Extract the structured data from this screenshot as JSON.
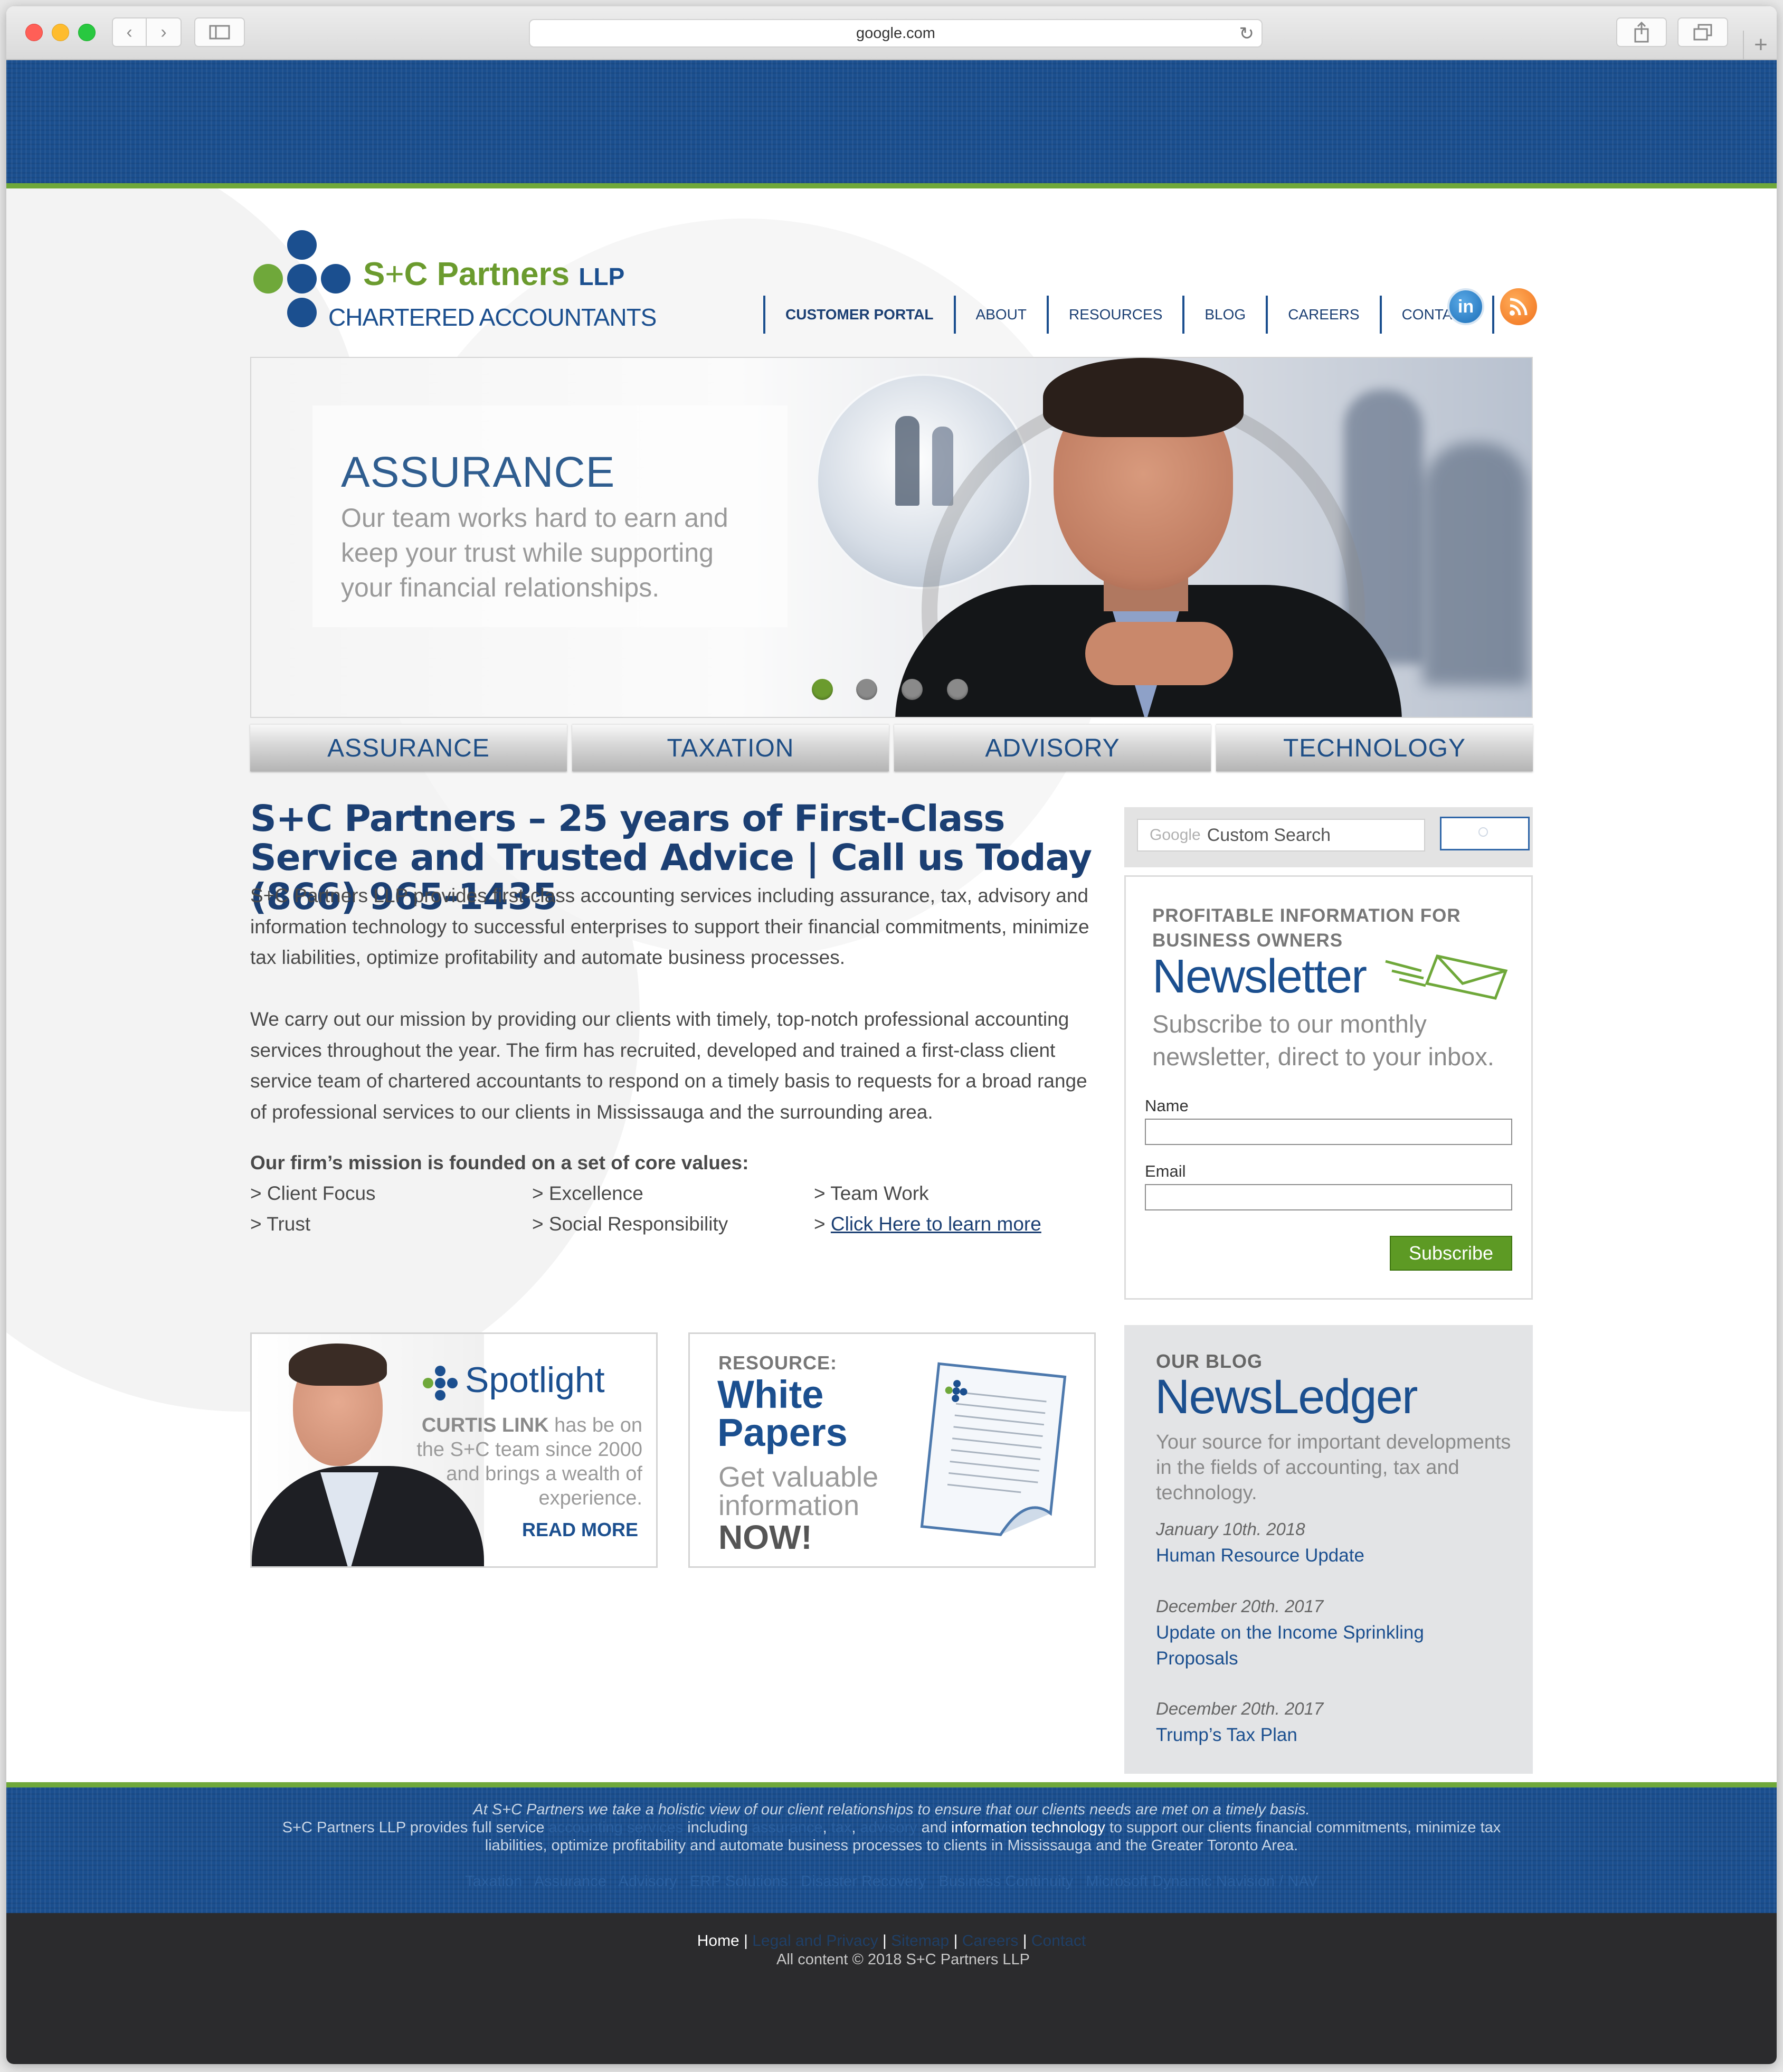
{
  "browser": {
    "url": "google.com",
    "colors": {
      "close": "#ff5f57",
      "minimize": "#febc2e",
      "maximize": "#28c840"
    }
  },
  "logo": {
    "name_s": "S",
    "name_plus": "+",
    "name_rest": "C Partners ",
    "name_llp": "LLP",
    "subtitle": "CHARTERED ACCOUNTANTS"
  },
  "nav": {
    "items": [
      "CUSTOMER PORTAL",
      "ABOUT",
      "RESOURCES",
      "BLOG",
      "CAREERS",
      "CONTACT"
    ],
    "social": {
      "linkedin": "in",
      "rss_icon": "rss-icon"
    }
  },
  "hero": {
    "title": "ASSURANCE",
    "text": "Our team works hard to earn and keep your trust while supporting your financial relationships.",
    "slides": 4,
    "active_slide": 1
  },
  "services": [
    "ASSURANCE",
    "TAXATION",
    "ADVISORY",
    "TECHNOLOGY"
  ],
  "main": {
    "headline": "S+C Partners – 25 years of First-Class Service and Trusted Advice | Call us Today (866) 965-1435",
    "paragraph1": "S+C Partners LLP provides first-class accounting services including assurance, tax, advisory and information technology to successful enterprises to support their financial commitments, minimize tax liabilities, optimize profitability and automate business processes.",
    "paragraph2": "We carry out our mission by providing our clients with timely, top-notch professional accounting services throughout the year. The firm has recruited, developed and trained a first-class client service team of chartered accountants to respond on a timely basis to requests for a broad range of professional services to our clients in Mississauga and the surrounding area.",
    "values_heading": "Our firm’s mission is founded on a set of core values:",
    "values": [
      "> Client Focus",
      "> Excellence",
      "> Team Work",
      "> Trust",
      "> Social Responsibility"
    ],
    "learn_more_prefix": "> ",
    "learn_more_link": "Click Here to learn more"
  },
  "spotlight": {
    "title": "Spotlight",
    "name": "CURTIS LINK",
    "text": " has be on the S+C team since 2000 and brings a wealth of experience.",
    "cta": "READ MORE"
  },
  "whitepapers": {
    "kicker": "RESOURCE:",
    "title_line1": "White",
    "title_line2": "Papers",
    "text_line1": "Get valuable",
    "text_line2": "information",
    "text_line3": "NOW!"
  },
  "search": {
    "brand": "Google",
    "placeholder": "Custom Search"
  },
  "newsletter": {
    "kicker": "PROFITABLE INFORMATION FOR BUSINESS OWNERS",
    "title": "Newsletter",
    "text": "Subscribe to our monthly newsletter, direct to your inbox.",
    "name_label": "Name",
    "email_label": "Email",
    "subscribe_label": "Subscribe"
  },
  "blog": {
    "kicker": "OUR BLOG",
    "title": "NewsLedger",
    "text": "Your source for important developments in the fields of accounting, tax and technology.",
    "posts": [
      {
        "date": "January 10th. 2018",
        "title": "Human Resource Update"
      },
      {
        "date": "December 20th. 2017",
        "title": "Update on the Income Sprinkling Proposals"
      },
      {
        "date": "December 20th. 2017",
        "title": "Trump’s Tax Plan"
      }
    ]
  },
  "footer": {
    "tagline": "At S+C Partners we take a holistic view of our client relationships to ensure that our clients needs are met on a timely basis.",
    "line2_a": "S+C Partners LLP provides full service ",
    "line2_b": "accounting services",
    "line2_c": " including ",
    "line2_d": "assurance",
    "line2_e": ", ",
    "line2_f": "tax",
    "line2_g": ", ",
    "line2_h": "advisory",
    "line2_i": " and ",
    "line2_j": "information technology",
    "line2_k": " to support our clients financial commitments, minimize tax",
    "line3": "liabilities, optimize profitability and automate business processes to clients in Mississauga and the Greater Toronto Area.",
    "links": [
      "Taxation",
      "Assurance",
      "Advisory",
      "ERP Solutions",
      "Disaster Recovery",
      "Business Continuity",
      "Microsoft Dynamic Navision / NAV"
    ],
    "bottom_home": "Home",
    "bottom_links": [
      "Legal and Privacy",
      "Sitemap",
      "Careers",
      "Contact"
    ],
    "copyright": "All content © 2018 S+C Partners LLP"
  }
}
